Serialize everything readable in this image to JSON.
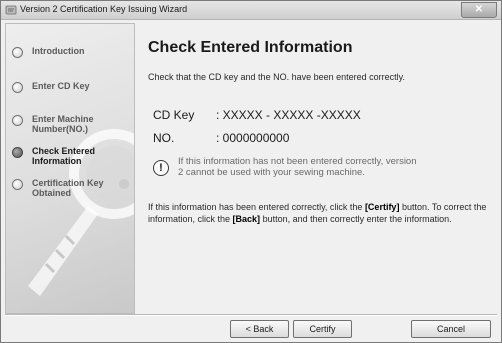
{
  "window": {
    "title": "Version 2 Certification Key Issuing Wizard",
    "close_glyph": "✕"
  },
  "sidebar": {
    "steps": [
      {
        "label": "Introduction",
        "active": false
      },
      {
        "label": "Enter CD Key",
        "active": false
      },
      {
        "label": "Enter Machine Number(NO.)",
        "active": false
      },
      {
        "label": "Check Entered Information",
        "active": true
      },
      {
        "label": "Certification Key Obtained",
        "active": false
      }
    ]
  },
  "main": {
    "heading": "Check Entered Information",
    "intro": "Check that the CD key and the NO. have been entered correctly.",
    "cd_key_label": "CD Key",
    "cd_key_value": ": XXXXX - XXXXX  -XXXXX",
    "no_label": "NO.",
    "no_value": ": 0000000000",
    "warning_glyph": "!",
    "warning": "If this information has not been entered correctly, version 2 cannot be used with your sewing machine.",
    "instr_1": "If this information has been entered correctly, click the ",
    "instr_certify": "[Certify]",
    "instr_2": " button. To correct the information, click the ",
    "instr_back": "[Back]",
    "instr_3": " button, and then correctly enter the information."
  },
  "buttons": {
    "back": "< Back",
    "certify": "Certify",
    "cancel": "Cancel"
  }
}
